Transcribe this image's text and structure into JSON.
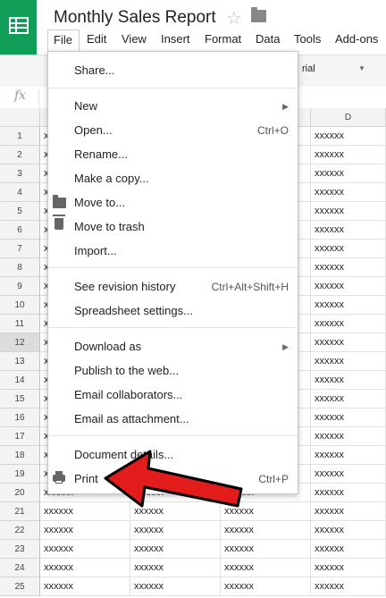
{
  "document": {
    "title": "Monthly Sales Report"
  },
  "menubar": {
    "items": [
      "File",
      "Edit",
      "View",
      "Insert",
      "Format",
      "Data",
      "Tools",
      "Add-ons"
    ]
  },
  "toolbar": {
    "font_name": "rial"
  },
  "formula_bar": {
    "fx_label": "fx"
  },
  "grid": {
    "column_d_header": "D",
    "rows": [
      "1",
      "2",
      "3",
      "4",
      "5",
      "6",
      "7",
      "8",
      "9",
      "10",
      "11",
      "12",
      "13",
      "14",
      "15",
      "16",
      "17",
      "18",
      "19",
      "20",
      "21",
      "22",
      "23",
      "24",
      "25"
    ],
    "selected_row": "12",
    "cell_value": "xxxxxx",
    "col_a_partial": "x"
  },
  "file_menu": {
    "items": [
      {
        "label": "Share...",
        "shortcut": "",
        "submenu": false
      },
      {
        "label": "New",
        "shortcut": "",
        "submenu": true
      },
      {
        "label": "Open...",
        "shortcut": "Ctrl+O",
        "submenu": false
      },
      {
        "label": "Rename...",
        "shortcut": "",
        "submenu": false
      },
      {
        "label": "Make a copy...",
        "shortcut": "",
        "submenu": false
      },
      {
        "label": "Move to...",
        "shortcut": "",
        "submenu": false,
        "icon": "folder-icon"
      },
      {
        "label": "Move to trash",
        "shortcut": "",
        "submenu": false,
        "icon": "trash-icon"
      },
      {
        "label": "Import...",
        "shortcut": "",
        "submenu": false
      },
      {
        "label": "See revision history",
        "shortcut": "Ctrl+Alt+Shift+H",
        "submenu": false
      },
      {
        "label": "Spreadsheet settings...",
        "shortcut": "",
        "submenu": false
      },
      {
        "label": "Download as",
        "shortcut": "",
        "submenu": true
      },
      {
        "label": "Publish to the web...",
        "shortcut": "",
        "submenu": false
      },
      {
        "label": "Email collaborators...",
        "shortcut": "",
        "submenu": false
      },
      {
        "label": "Email as attachment...",
        "shortcut": "",
        "submenu": false
      },
      {
        "label": "Document details...",
        "shortcut": "",
        "submenu": false
      },
      {
        "label": "Print",
        "shortcut": "Ctrl+P",
        "submenu": false,
        "icon": "printer-icon"
      }
    ]
  },
  "annotation": {
    "arrow_color": "#e21b1b",
    "points_to": "Print"
  },
  "colors": {
    "brand": "#0f9d58"
  }
}
